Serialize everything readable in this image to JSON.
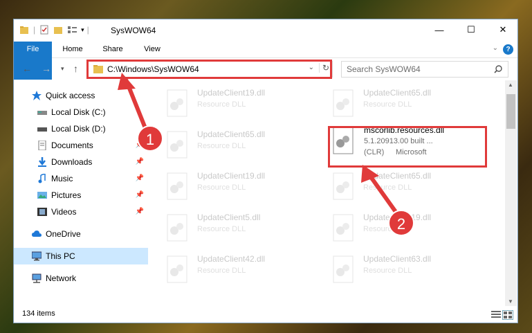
{
  "window": {
    "title": "SysWOW64",
    "quick_access_separator": "|",
    "controls": {
      "minimize": "—",
      "maximize": "☐",
      "close": "✕"
    }
  },
  "ribbon": {
    "tabs": [
      "File",
      "Home",
      "Share",
      "View"
    ],
    "expand_icon": "chevron-down-icon",
    "help": "?"
  },
  "address": {
    "path": "C:\\Windows\\SysWOW64",
    "search_placeholder": "Search SysWOW64"
  },
  "nav": {
    "items": [
      {
        "label": "Quick access",
        "icon": "star-icon",
        "pinned": false
      },
      {
        "label": "Local Disk (C:)",
        "icon": "drive-icon",
        "pinned": false
      },
      {
        "label": "Local Disk (D:)",
        "icon": "drive-icon",
        "pinned": false
      },
      {
        "label": "Documents",
        "icon": "documents-icon",
        "pinned": true
      },
      {
        "label": "Downloads",
        "icon": "download-icon",
        "pinned": true
      },
      {
        "label": "Music",
        "icon": "music-icon",
        "pinned": true
      },
      {
        "label": "Pictures",
        "icon": "pictures-icon",
        "pinned": true
      },
      {
        "label": "Videos",
        "icon": "videos-icon",
        "pinned": true
      },
      {
        "label": "OneDrive",
        "icon": "cloud-icon",
        "pinned": false
      },
      {
        "label": "This PC",
        "icon": "computer-icon",
        "pinned": false,
        "selected": true
      },
      {
        "label": "Network",
        "icon": "network-icon",
        "pinned": false
      }
    ]
  },
  "files": {
    "col1": [
      {
        "name": "UpdateClient19.dll",
        "type": "Resource DLL"
      },
      {
        "name": "UpdateClient65.dll",
        "type": "Resource DLL"
      },
      {
        "name": "UpdateClient19.dll",
        "type": "Resource DLL"
      },
      {
        "name": "UpdateClient5.dll",
        "type": "Resource DLL"
      },
      {
        "name": "UpdateClient42.dll",
        "type": "Resource DLL"
      }
    ],
    "col2": [
      {
        "name": "UpdateClient65.dll",
        "type": "Resource DLL"
      },
      {
        "name": "UpdateClient65.dll",
        "type": "Resource DLL"
      },
      {
        "name": "UpdateClient19.dll",
        "type": "Resource DLL"
      },
      {
        "name": "UpdateClient63.dll",
        "type": "Resource DLL"
      }
    ],
    "highlighted": {
      "name": "mscorlib.resources.dll",
      "version": "5.1.20913.00 built ...",
      "clr": "(CLR)",
      "company": "Microsoft"
    }
  },
  "status": {
    "count": "134 items"
  },
  "annotations": {
    "step1": "1",
    "step2": "2",
    "color": "#e03a3a"
  }
}
